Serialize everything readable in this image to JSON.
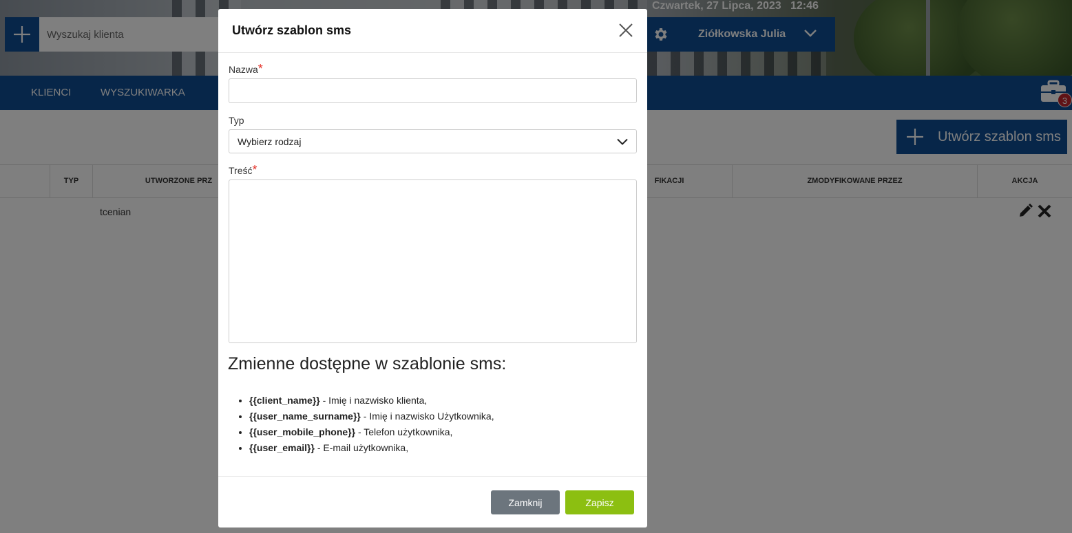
{
  "header": {
    "datetime": "Czwartek, 27 Lipca, 2023   12:46",
    "search_placeholder": "Wyszukaj klienta",
    "user_name": "Ziółkowska Julia",
    "notification_count": "3"
  },
  "nav": {
    "items": [
      "KLIENCI",
      "WYSZUKIWARKA"
    ]
  },
  "page": {
    "create_button_label": "Utwórz szablon sms"
  },
  "table": {
    "columns": [
      "TYP",
      "UTWORZONE PRZ",
      "FIKACJI",
      "ZMODYFIKOWANE PRZEZ",
      "AKCJA"
    ],
    "rows": [
      {
        "created_by": "tcenian"
      }
    ]
  },
  "modal": {
    "title": "Utwórz szablon sms",
    "name_label": "Nazwa",
    "name_value": "",
    "type_label": "Typ",
    "type_value": "Wybierz rodzaj",
    "content_label": "Treść",
    "content_value": "",
    "required_mark": "*",
    "vars_title": "Zmienne dostępne w szablonie sms:",
    "variables": [
      {
        "key": "{{client_name}}",
        "desc": " - Imię i nazwisko klienta,"
      },
      {
        "key": "{{user_name_surname}}",
        "desc": " - Imię i nazwisko Użytkownika,"
      },
      {
        "key": "{{user_mobile_phone}}",
        "desc": " - Telefon użytkownika,"
      },
      {
        "key": "{{user_email}}",
        "desc": " - E-mail użytkownika,"
      }
    ],
    "close_label": "Zamknij",
    "save_label": "Zapisz"
  },
  "colors": {
    "brand_blue": "#0e4c92",
    "close_button": "#6c757d",
    "save_button": "#8cbf11",
    "required": "#e4342b"
  }
}
